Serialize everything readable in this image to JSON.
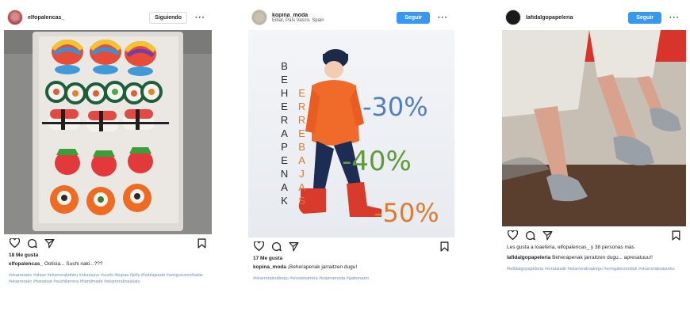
{
  "posts": [
    {
      "username": "elfopalencas_",
      "follow_label": "Siguiendo",
      "more": "···",
      "likes": "18 Me gusta",
      "caption_user": "elfopalencas_",
      "caption_text": "Ootisia... Sushi naki...???",
      "tags": "#ekarrerako #ahiaz #ekarrerakohiru #ekariayur #sushi #kupaa #jelly #hobiajarate #amiguruminihalaz #ekarrerako #hanaisat #sushilarrera #handmade #ekarrerakoaskatu"
    },
    {
      "username": "kopina_moda",
      "location": "Eibar, País Vasco, Spain",
      "follow_label": "Seguir",
      "more": "···",
      "likes": "17 Me gusta",
      "caption_user": "kopina_moda",
      "caption_text": "¡Beherapenak jarraitzen dugu!",
      "tags": "#ekarrerakoabegu #erosiekarrera #kopinamoda #gabonazio",
      "sale": {
        "word1": "BEHERAPENAK",
        "word2": "ERREBAJAS",
        "pct1": "-30%",
        "pct2": "-40%",
        "pct3": "-50%",
        "color1": "#4e7fc2",
        "color2": "#5f9b38",
        "color3": "#e07a2c",
        "word1_color": "#2c2c2c",
        "word2_color": "#e07a2c"
      }
    },
    {
      "username": "lafidalgopapeleria",
      "follow_label": "Seguir",
      "more": "···",
      "likes_line": "Les gusta a loaeferia, elfopalencas_ y 38 personas más",
      "caption_user": "lafidalgopapeleria",
      "caption_text": "Beherapenak jarraitzen dugu... apresatuuu!!",
      "tags": "#lafidalgopapeleria #errataizak #ekarrerakoakegu #erregaleciendak #ekarrerakoatzeko"
    }
  ],
  "icons": [
    "heart-icon",
    "comment-icon",
    "share-icon",
    "bookmark-icon"
  ],
  "colors": {
    "accent": "#3897f0",
    "text": "#262626",
    "hashtag": "#6d8fbf"
  }
}
